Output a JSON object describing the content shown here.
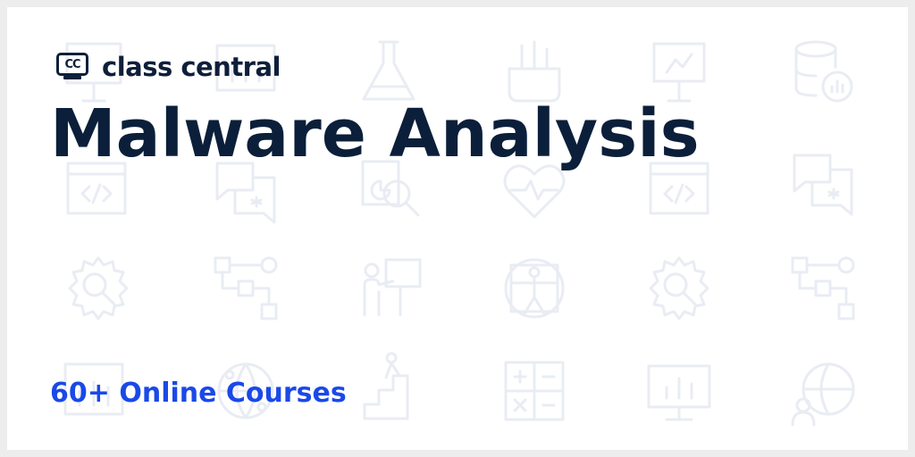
{
  "brand": {
    "logo_mark_text": "CC",
    "name": "class central"
  },
  "heading": {
    "title": "Malware Analysis",
    "subtitle": "60+ Online Courses"
  },
  "background": {
    "icons": [
      "easel-icon",
      "bar-chart-icon",
      "flask-icon",
      "pencil-cup-icon",
      "easel-icon",
      "database-chart-icon",
      "code-window-icon",
      "chat-bubble-icon",
      "magnifier-chart-icon",
      "heart-pulse-icon",
      "code-window-icon",
      "chat-bubble-icon",
      "gear-magnifier-icon",
      "flowchart-icon",
      "presenter-icon",
      "vitruvian-icon",
      "gear-magnifier-icon",
      "flowchart-icon",
      "bar-chart-icon",
      "globe-network-icon",
      "career-stairs-icon",
      "calculator-icon",
      "presentation-board-icon",
      "person-network-icon"
    ]
  },
  "colors": {
    "card_background": "#ffffff",
    "page_border": "#ededed",
    "title": "#0b1f3a",
    "subtitle_accent": "#1a49e8",
    "icon_watermark": "#e9ecf3"
  }
}
